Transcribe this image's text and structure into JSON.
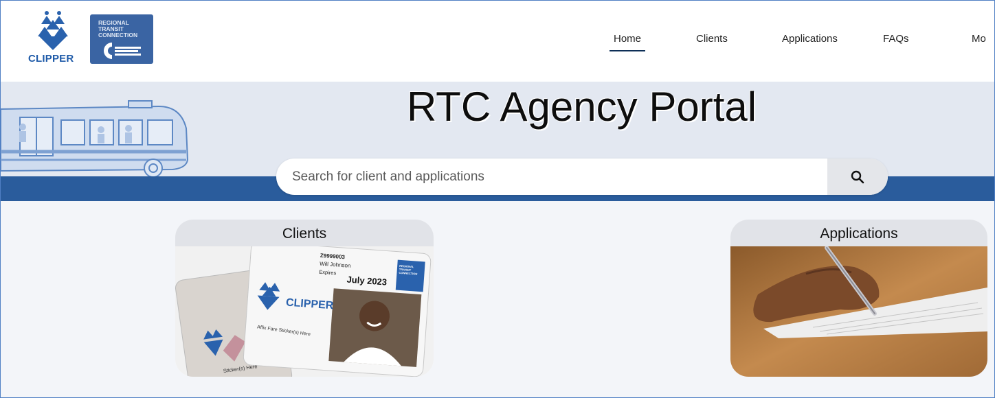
{
  "logos": {
    "clipper_text": "CLIPPER",
    "rtc_lines": [
      "REGIONAL",
      "TRANSIT",
      "CONNECTION"
    ]
  },
  "nav": {
    "items": [
      {
        "label": "Home",
        "active": true
      },
      {
        "label": "Clients",
        "active": false
      },
      {
        "label": "Applications",
        "active": false
      },
      {
        "label": "FAQs",
        "active": false
      },
      {
        "label": "Mo",
        "active": false
      }
    ]
  },
  "banner": {
    "title": "RTC Agency Portal"
  },
  "search": {
    "placeholder": "Search for client and applications"
  },
  "tiles": {
    "clients": {
      "label": "Clients",
      "card": {
        "id": "Z9999003",
        "name": "Will Johnson",
        "expires_label": "Expires",
        "expires": "July 2023",
        "brand": "CLIPPER",
        "sticker": "Affix Fare Sticker(s) Here",
        "back_sticker": "Sticker(s) Here",
        "rtc_lines": [
          "REGIONAL",
          "TRANSIT",
          "CONNECTION"
        ]
      }
    },
    "applications": {
      "label": "Applications"
    }
  },
  "colors": {
    "brand_blue": "#2a5c9c",
    "clipper_blue": "#1e5aa8",
    "nav_underline": "#0d2f57"
  }
}
